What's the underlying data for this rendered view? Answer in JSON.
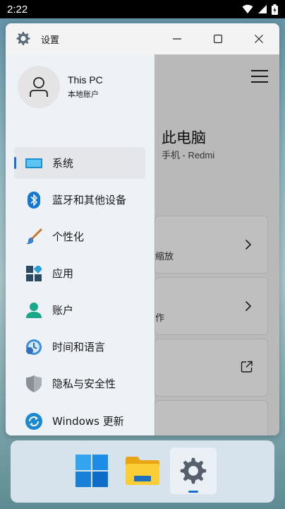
{
  "status_bar": {
    "time": "2:22"
  },
  "window": {
    "title": "设置",
    "controls": [
      "minimize",
      "maximize",
      "close"
    ]
  },
  "profile": {
    "name": "This PC",
    "subtitle": "本地账户"
  },
  "nav": {
    "items": [
      {
        "label": "系统",
        "icon": "system-icon",
        "active": true
      },
      {
        "label": "蓝牙和其他设备",
        "icon": "bluetooth-icon"
      },
      {
        "label": "个性化",
        "icon": "brush-icon"
      },
      {
        "label": "应用",
        "icon": "apps-icon"
      },
      {
        "label": "账户",
        "icon": "account-icon"
      },
      {
        "label": "时间和语言",
        "icon": "time-language-icon"
      },
      {
        "label": "隐私与安全性",
        "icon": "shield-icon"
      },
      {
        "label": "Windows 更新",
        "icon": "update-icon"
      }
    ]
  },
  "content": {
    "title": "此电脑",
    "subtitle": "手机 - Redmi",
    "cards": [
      {
        "partial_text": "缩放"
      },
      {
        "partial_text": "作"
      }
    ]
  },
  "taskbar": {
    "apps": [
      {
        "name": "start",
        "icon": "windows-logo-icon"
      },
      {
        "name": "file-explorer",
        "icon": "folder-icon"
      },
      {
        "name": "settings",
        "icon": "gear-icon",
        "running": true
      }
    ]
  },
  "colors": {
    "accent": "#1a6ed8"
  }
}
